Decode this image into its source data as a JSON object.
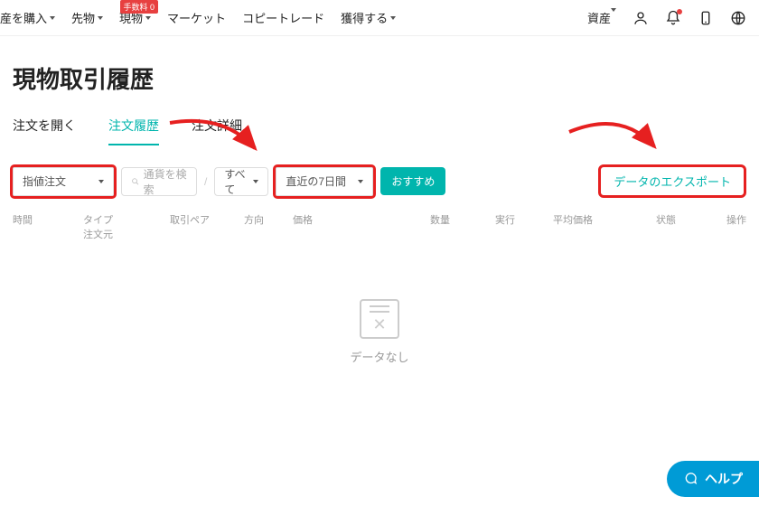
{
  "topnav": {
    "left": [
      {
        "label": "産を購入",
        "has_caret": true
      },
      {
        "label": "先物",
        "has_caret": true
      },
      {
        "label": "現物",
        "has_caret": true,
        "badge": "手数料 0"
      },
      {
        "label": "マーケット",
        "has_caret": false
      },
      {
        "label": "コピートレード",
        "has_caret": false
      },
      {
        "label": "獲得する",
        "has_caret": true
      }
    ],
    "right_assets": "資産"
  },
  "page_title": "現物取引履歴",
  "tabs": [
    {
      "label": "注文を開く",
      "active": false
    },
    {
      "label": "注文履歴",
      "active": true
    },
    {
      "label": "注文詳細",
      "active": false
    }
  ],
  "filters": {
    "order_type": "指値注文",
    "pair_placeholder": "通貨を検索",
    "side": "すべて",
    "period": "直近の7日間",
    "recommend_btn": "おすすめ",
    "export_label": "データのエクスポート"
  },
  "divider": "/",
  "columns": {
    "time": "時間",
    "type_line1": "タイプ",
    "type_line2": "注文元",
    "pair": "取引ペア",
    "direction": "方向",
    "price": "価格",
    "quantity": "数量",
    "executed": "実行",
    "avg_price": "平均価格",
    "status": "状態",
    "operation": "操作"
  },
  "empty_text": "データなし",
  "help_label": "ヘルプ"
}
